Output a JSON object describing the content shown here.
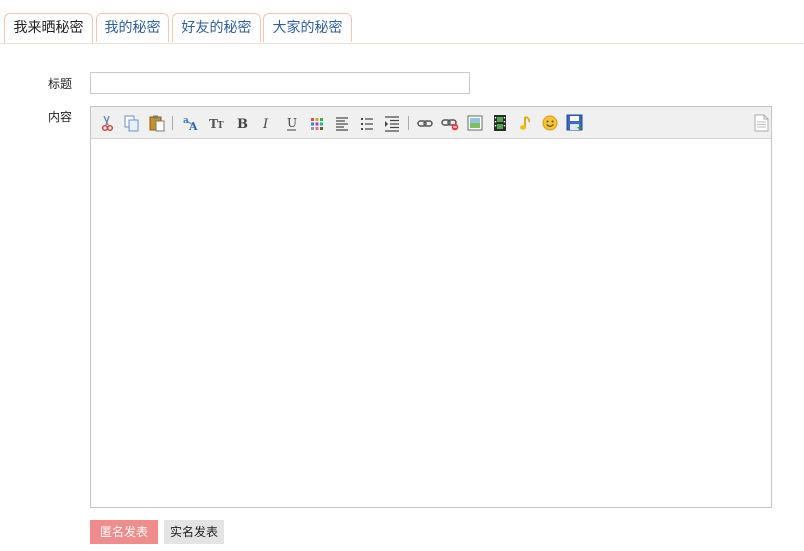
{
  "tabs": [
    {
      "label": "我来晒秘密",
      "active": true
    },
    {
      "label": "我的秘密",
      "active": false
    },
    {
      "label": "好友的秘密",
      "active": false
    },
    {
      "label": "大家的秘密",
      "active": false
    }
  ],
  "form": {
    "title_label": "标题",
    "title_value": "",
    "content_label": "内容"
  },
  "toolbar": {
    "tools": [
      "cut-icon",
      "copy-icon",
      "paste-icon",
      "font-family-icon",
      "font-size-icon",
      "bold-icon",
      "italic-icon",
      "underline-icon",
      "text-color-icon",
      "align-icon",
      "list-icon",
      "indent-icon",
      "link-icon",
      "unlink-icon",
      "image-icon",
      "video-icon",
      "music-icon",
      "emoticon-icon",
      "save-icon",
      "source-icon"
    ]
  },
  "buttons": {
    "anonymous_post": "匿名发表",
    "real_name_post": "实名发表"
  },
  "colors": {
    "accent_button": "#f08c8c",
    "tab_border": "#f0c8b8",
    "tab_link": "#2f5f9a"
  }
}
